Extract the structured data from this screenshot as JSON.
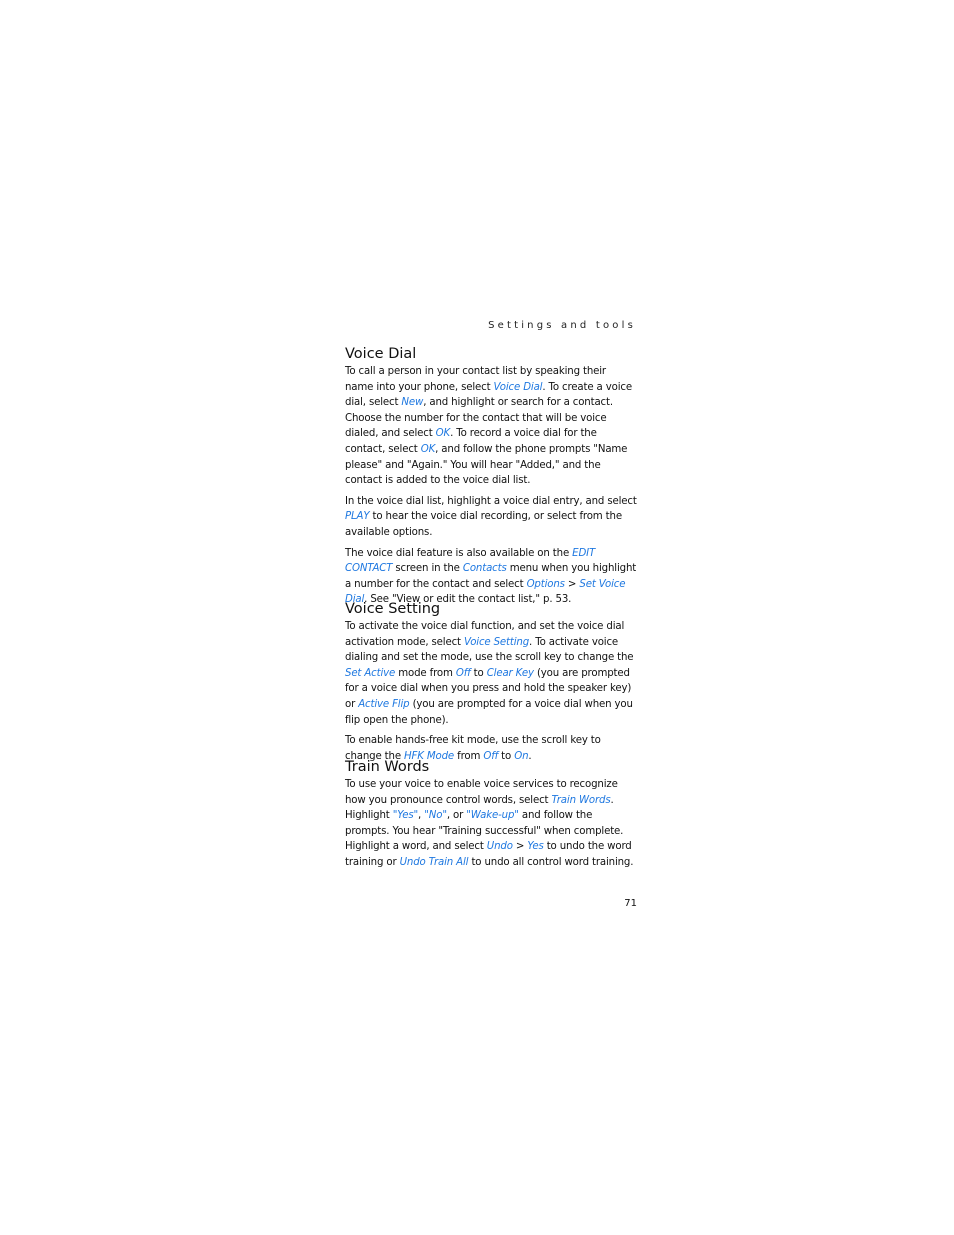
{
  "running_head": "Settings and tools",
  "page_number": "71",
  "link_color": "#1f78e0",
  "sections": [
    {
      "title": "Voice Dial",
      "paragraphs": [
        [
          {
            "t": "To call a person in your contact list by speaking their name into your phone, select "
          },
          {
            "t": "Voice Dial",
            "link": true
          },
          {
            "t": ". To create a voice dial, select "
          },
          {
            "t": "New",
            "link": true
          },
          {
            "t": ", and highlight or search for a contact. Choose the number for the contact that will be voice dialed, and select "
          },
          {
            "t": "OK",
            "link": true
          },
          {
            "t": ". To record a voice dial for the contact, select "
          },
          {
            "t": "OK",
            "link": true
          },
          {
            "t": ", and follow the phone prompts \"Name please\" and \"Again.\" You will hear \"Added,\" and the contact is added to the voice dial list."
          }
        ],
        [
          {
            "t": "In the voice dial list, highlight a voice dial entry, and select "
          },
          {
            "t": "PLAY",
            "link": true
          },
          {
            "t": " to hear the voice dial recording, or select from the available options."
          }
        ],
        [
          {
            "t": "The voice dial feature is also available on the "
          },
          {
            "t": "EDIT CONTACT",
            "link": true
          },
          {
            "t": " screen in the "
          },
          {
            "t": "Contacts",
            "link": true
          },
          {
            "t": " menu when you highlight a number for the contact and select "
          },
          {
            "t": "Options",
            "link": true
          },
          {
            "t": " > "
          },
          {
            "t": "Set Voice Dial",
            "link": true
          },
          {
            "t": ". See \"View or edit the contact list,\" p. 53."
          }
        ]
      ]
    },
    {
      "title": "Voice Setting",
      "paragraphs": [
        [
          {
            "t": "To activate the voice dial function, and set the voice dial activation mode, select "
          },
          {
            "t": "Voice Setting",
            "link": true
          },
          {
            "t": ". To activate voice dialing and set the mode, use the scroll key to change the "
          },
          {
            "t": "Set Active",
            "link": true
          },
          {
            "t": " mode from "
          },
          {
            "t": "Off",
            "link": true
          },
          {
            "t": " to "
          },
          {
            "t": "Clear Key",
            "link": true
          },
          {
            "t": " (you are prompted for a voice dial when you press and hold the speaker key) or "
          },
          {
            "t": "Active Flip",
            "link": true
          },
          {
            "t": " (you are prompted for a voice dial when you flip open the phone)."
          }
        ],
        [
          {
            "t": "To enable hands-free kit mode, use the scroll key to change the "
          },
          {
            "t": "HFK Mode",
            "link": true
          },
          {
            "t": " from "
          },
          {
            "t": "Off",
            "link": true
          },
          {
            "t": " to "
          },
          {
            "t": "On",
            "link": true
          },
          {
            "t": "."
          }
        ]
      ]
    },
    {
      "title": "Train Words",
      "paragraphs": [
        [
          {
            "t": "To use your voice to enable voice services to recognize how you pronounce control words, select "
          },
          {
            "t": "Train Words",
            "link": true
          },
          {
            "t": ". Highlight "
          },
          {
            "t": "\"Yes\"",
            "link": true
          },
          {
            "t": ", "
          },
          {
            "t": "\"No\"",
            "link": true
          },
          {
            "t": ", or "
          },
          {
            "t": "\"Wake-up\"",
            "link": true
          },
          {
            "t": " and follow the prompts. You hear \"Training successful\" when complete. Highlight a word, and select "
          },
          {
            "t": "Undo",
            "link": true
          },
          {
            "t": " > "
          },
          {
            "t": "Yes",
            "link": true
          },
          {
            "t": " to undo the word training or "
          },
          {
            "t": "Undo Train All",
            "link": true
          },
          {
            "t": " to undo all control word training."
          }
        ]
      ]
    }
  ]
}
